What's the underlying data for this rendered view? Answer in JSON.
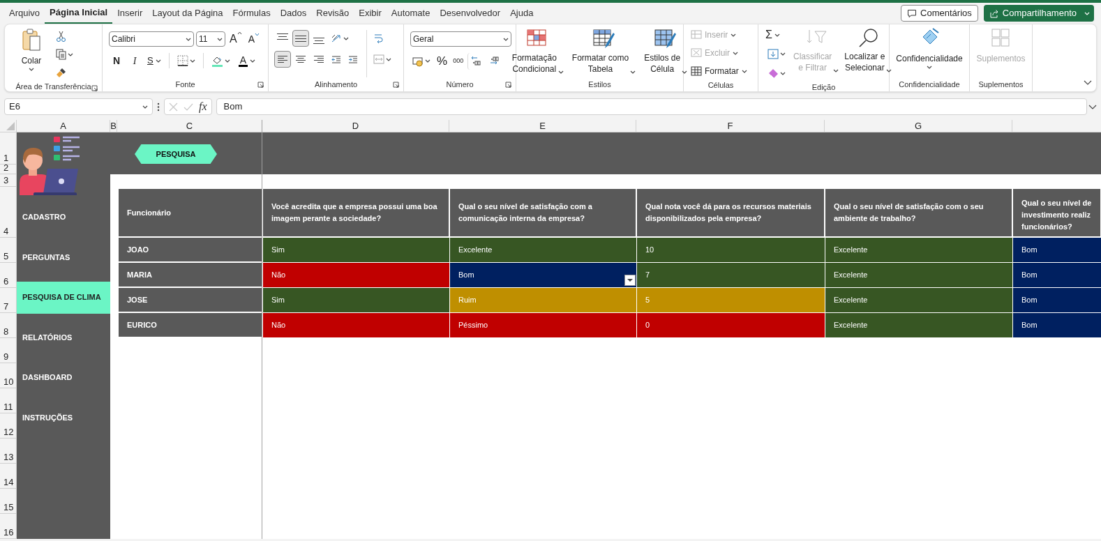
{
  "menu_tabs": [
    {
      "label": "Arquivo",
      "selected": false
    },
    {
      "label": "Página Inicial",
      "selected": true
    },
    {
      "label": "Inserir",
      "selected": false
    },
    {
      "label": "Layout da Página",
      "selected": false
    },
    {
      "label": "Fórmulas",
      "selected": false
    },
    {
      "label": "Dados",
      "selected": false
    },
    {
      "label": "Revisão",
      "selected": false
    },
    {
      "label": "Exibir",
      "selected": false
    },
    {
      "label": "Automate",
      "selected": false
    },
    {
      "label": "Desenvolvedor",
      "selected": false
    },
    {
      "label": "Ajuda",
      "selected": false
    }
  ],
  "header_buttons": [
    {
      "kind": "comments",
      "label": "Comentários"
    },
    {
      "kind": "share",
      "label": "Compartilhamento"
    }
  ],
  "ribbon": {
    "clipboard": {
      "paste": "Colar",
      "label": "Área de Transferência"
    },
    "font": {
      "name": "Calibri",
      "size": "11",
      "grow": "A",
      "shrink": "A",
      "bold": "N",
      "italic": "I",
      "underline": "S",
      "color_letter": "A",
      "label": "Fonte"
    },
    "alignment": {
      "label": "Alinhamento",
      "vertical_align": [
        {
          "selected": false
        },
        {
          "selected": true
        },
        {
          "selected": false
        }
      ],
      "horizontal_align": [
        {
          "selected": true
        },
        {
          "selected": false
        },
        {
          "selected": false
        }
      ]
    },
    "number": {
      "format": "Geral",
      "percent": "%",
      "thousands": "000",
      "label": "Número"
    },
    "styles": {
      "label": "Estilos",
      "buttons": [
        {
          "kind": "conditional",
          "label": "Formatação\nCondicional"
        },
        {
          "kind": "table",
          "label": "Formatar como\nTabela"
        },
        {
          "kind": "cellstyle",
          "label": "Estilos de\nCélula"
        }
      ]
    },
    "cells": {
      "label": "Células",
      "buttons": [
        {
          "kind": "insert",
          "label": "Inserir",
          "disabled": true
        },
        {
          "kind": "delete",
          "label": "Excluir",
          "disabled": true
        },
        {
          "kind": "format",
          "label": "Formatar",
          "disabled": false
        }
      ]
    },
    "editing": {
      "label": "Edição",
      "sum": "Σ",
      "buttons": [
        {
          "kind": "sort",
          "label": "Classificar\ne Filtrar",
          "disabled": true
        },
        {
          "kind": "find",
          "label": "Localizar e\nSelecionar",
          "disabled": false
        }
      ]
    },
    "sensitivity": {
      "button": "Confidencialidade",
      "label": "Confidencialidade"
    },
    "addins": {
      "button": "Suplementos",
      "disabled": true,
      "label": "Suplementos"
    }
  },
  "formula_bar": {
    "name_box": "E6",
    "fx": "fx",
    "value": "Bom"
  },
  "sheet": {
    "columns": [
      "A",
      "B",
      "C",
      "D",
      "E",
      "F",
      "G"
    ],
    "rows": [
      "1",
      "2",
      "3",
      "4",
      "5",
      "6",
      "7",
      "8",
      "9",
      "10",
      "11",
      "12",
      "13",
      "14",
      "15",
      "16"
    ],
    "banner_button": "PESQUISA",
    "nav": [
      {
        "label": "CADASTRO",
        "selected": false
      },
      {
        "label": "PERGUNTAS",
        "selected": false
      },
      {
        "label": "PESQUISA DE CLIMA",
        "selected": true
      },
      {
        "label": "RELATÓRIOS",
        "selected": false
      },
      {
        "label": "DASHBOARD",
        "selected": false
      },
      {
        "label": "INSTRUÇÕES",
        "selected": false
      }
    ],
    "table": {
      "columns": [
        "Funcionário",
        "Você acredita que a empresa possui uma boa imagem perante a sociedade?",
        "Qual o seu nível de satisfação com a comunicação interna da empresa?",
        "Qual nota você dá para os recursos materiais disponibilizados pela empresa?",
        "Qual o seu nível de satisfação com o seu ambiente de trabalho?",
        "Qual o seu nível de\ninvestimento realiz\nfuncionários?"
      ],
      "rows": [
        {
          "cells": [
            {
              "kind": "name",
              "text": "JOAO",
              "dropdown": false
            },
            {
              "text": "Sim",
              "color": "#375623",
              "dropdown": false
            },
            {
              "text": "Excelente",
              "color": "#375623",
              "dropdown": false
            },
            {
              "text": "10",
              "color": "#375623",
              "dropdown": false
            },
            {
              "text": "Excelente",
              "color": "#375623",
              "dropdown": false
            },
            {
              "text": "Bom",
              "color": "#002060",
              "dropdown": false
            }
          ]
        },
        {
          "cells": [
            {
              "kind": "name",
              "text": "MARIA",
              "dropdown": false
            },
            {
              "text": "Não",
              "color": "#c00000",
              "dropdown": false
            },
            {
              "text": "Bom",
              "color": "#002060",
              "dropdown": true
            },
            {
              "text": "7",
              "color": "#375623",
              "dropdown": false
            },
            {
              "text": "Excelente",
              "color": "#375623",
              "dropdown": false
            },
            {
              "text": "Bom",
              "color": "#002060",
              "dropdown": false
            }
          ]
        },
        {
          "cells": [
            {
              "kind": "name",
              "text": "JOSE",
              "dropdown": false
            },
            {
              "text": "Sim",
              "color": "#375623",
              "dropdown": false
            },
            {
              "text": "Ruim",
              "color": "#bf8f00",
              "dropdown": false
            },
            {
              "text": "5",
              "color": "#bf8f00",
              "dropdown": false
            },
            {
              "text": "Excelente",
              "color": "#375623",
              "dropdown": false
            },
            {
              "text": "Bom",
              "color": "#002060",
              "dropdown": false
            }
          ]
        },
        {
          "cells": [
            {
              "kind": "name",
              "text": "EURICO",
              "dropdown": false
            },
            {
              "text": "Não",
              "color": "#c00000",
              "dropdown": false
            },
            {
              "text": "Péssimo",
              "color": "#c00000",
              "dropdown": false
            },
            {
              "text": "0",
              "color": "#c00000",
              "dropdown": false
            },
            {
              "text": "Excelente",
              "color": "#375623",
              "dropdown": false
            },
            {
              "text": "Bom",
              "color": "#002060",
              "dropdown": false
            }
          ]
        }
      ]
    }
  }
}
